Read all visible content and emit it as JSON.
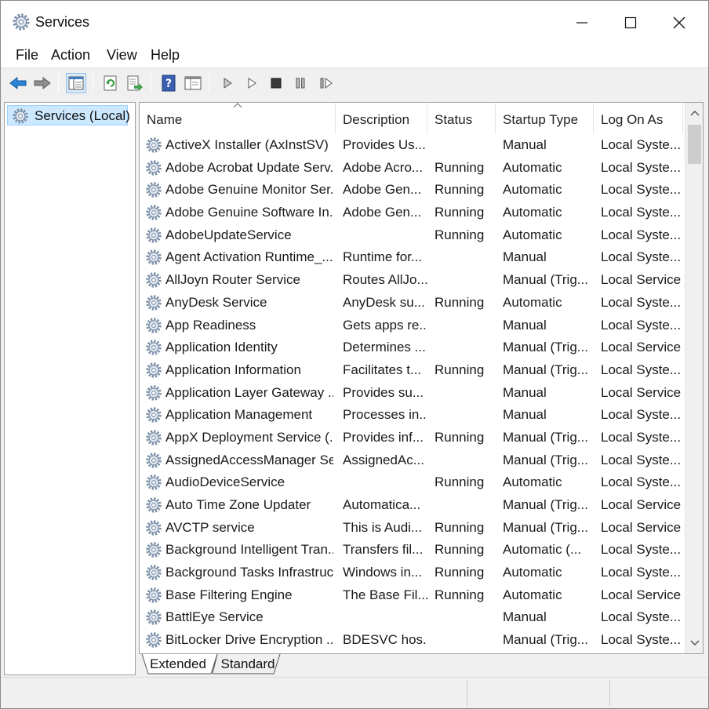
{
  "window": {
    "title": "Services",
    "icon": "gear-icon",
    "controls": [
      "minimize-icon",
      "maximize-icon",
      "close-icon"
    ]
  },
  "menu": [
    "File",
    "Action",
    "View",
    "Help"
  ],
  "toolbar": [
    "back-arrow-icon",
    "forward-arrow-icon",
    "show-hide-console-tree-icon",
    "refresh-icon",
    "export-list-icon",
    "help-icon",
    "properties-icon",
    "start-service-icon",
    "start-service-alt-icon",
    "stop-service-icon",
    "pause-service-icon",
    "restart-service-icon"
  ],
  "tree": {
    "label": "Services (Local)"
  },
  "columns": {
    "name": "Name",
    "description": "Description",
    "status": "Status",
    "startup": "Startup Type",
    "logon": "Log On As",
    "sorted_by": "Name"
  },
  "rows": [
    {
      "name": "ActiveX Installer (AxInstSV)",
      "description": "Provides Us...",
      "status": "",
      "startup": "Manual",
      "logon": "Local Syste..."
    },
    {
      "name": "Adobe Acrobat Update Serv...",
      "description": "Adobe Acro...",
      "status": "Running",
      "startup": "Automatic",
      "logon": "Local Syste..."
    },
    {
      "name": "Adobe Genuine Monitor Ser...",
      "description": "Adobe Gen...",
      "status": "Running",
      "startup": "Automatic",
      "logon": "Local Syste..."
    },
    {
      "name": "Adobe Genuine Software In...",
      "description": "Adobe Gen...",
      "status": "Running",
      "startup": "Automatic",
      "logon": "Local Syste..."
    },
    {
      "name": "AdobeUpdateService",
      "description": "",
      "status": "Running",
      "startup": "Automatic",
      "logon": "Local Syste..."
    },
    {
      "name": "Agent Activation Runtime_...",
      "description": "Runtime for...",
      "status": "",
      "startup": "Manual",
      "logon": "Local Syste..."
    },
    {
      "name": "AllJoyn Router Service",
      "description": "Routes AllJo...",
      "status": "",
      "startup": "Manual (Trig...",
      "logon": "Local Service"
    },
    {
      "name": "AnyDesk Service",
      "description": "AnyDesk su...",
      "status": "Running",
      "startup": "Automatic",
      "logon": "Local Syste..."
    },
    {
      "name": "App Readiness",
      "description": "Gets apps re...",
      "status": "",
      "startup": "Manual",
      "logon": "Local Syste..."
    },
    {
      "name": "Application Identity",
      "description": "Determines ...",
      "status": "",
      "startup": "Manual (Trig...",
      "logon": "Local Service"
    },
    {
      "name": "Application Information",
      "description": "Facilitates t...",
      "status": "Running",
      "startup": "Manual (Trig...",
      "logon": "Local Syste..."
    },
    {
      "name": "Application Layer Gateway ...",
      "description": "Provides su...",
      "status": "",
      "startup": "Manual",
      "logon": "Local Service"
    },
    {
      "name": "Application Management",
      "description": "Processes in...",
      "status": "",
      "startup": "Manual",
      "logon": "Local Syste..."
    },
    {
      "name": "AppX Deployment Service (...",
      "description": "Provides inf...",
      "status": "Running",
      "startup": "Manual (Trig...",
      "logon": "Local Syste..."
    },
    {
      "name": "AssignedAccessManager Se...",
      "description": "AssignedAc...",
      "status": "",
      "startup": "Manual (Trig...",
      "logon": "Local Syste..."
    },
    {
      "name": "AudioDeviceService",
      "description": "",
      "status": "Running",
      "startup": "Automatic",
      "logon": "Local Syste..."
    },
    {
      "name": "Auto Time Zone Updater",
      "description": "Automatica...",
      "status": "",
      "startup": "Manual (Trig...",
      "logon": "Local Service"
    },
    {
      "name": "AVCTP service",
      "description": "This is Audi...",
      "status": "Running",
      "startup": "Manual (Trig...",
      "logon": "Local Service"
    },
    {
      "name": "Background Intelligent Tran...",
      "description": "Transfers fil...",
      "status": "Running",
      "startup": "Automatic (...",
      "logon": "Local Syste..."
    },
    {
      "name": "Background Tasks Infrastruc...",
      "description": "Windows in...",
      "status": "Running",
      "startup": "Automatic",
      "logon": "Local Syste..."
    },
    {
      "name": "Base Filtering Engine",
      "description": "The Base Fil...",
      "status": "Running",
      "startup": "Automatic",
      "logon": "Local Service"
    },
    {
      "name": "BattlEye Service",
      "description": "",
      "status": "",
      "startup": "Manual",
      "logon": "Local Syste..."
    },
    {
      "name": "BitLocker Drive Encryption ...",
      "description": "BDESVC hos...",
      "status": "",
      "startup": "Manual (Trig...",
      "logon": "Local Syste..."
    }
  ],
  "tabs": [
    {
      "label": "Extended",
      "selected": true
    },
    {
      "label": "Standard",
      "selected": false
    }
  ],
  "colors": {
    "selection": "#cce8ff",
    "selection_border": "#99d1ff",
    "toolbar_arrow": "#1e7fd8",
    "chrome": "#f0f0f0"
  }
}
